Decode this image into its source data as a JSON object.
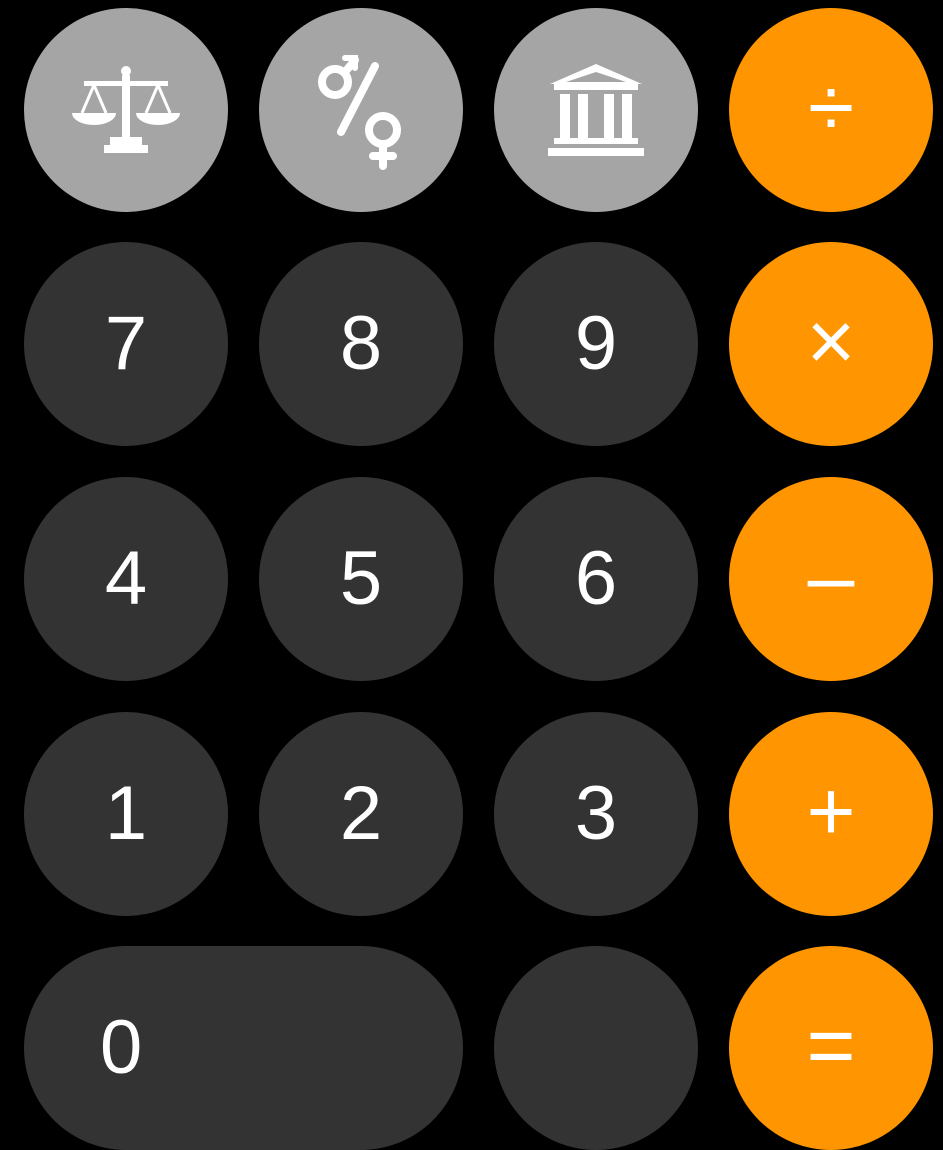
{
  "colors": {
    "background": "#000000",
    "function_key": "#a5a5a5",
    "number_key": "#333333",
    "operator_key": "#ff9500",
    "key_text": "#ffffff"
  },
  "function_keys": [
    {
      "icon": "balance-scale-icon"
    },
    {
      "icon": "male-female-percent-icon"
    },
    {
      "icon": "bank-building-icon"
    }
  ],
  "digits": {
    "seven": "7",
    "eight": "8",
    "nine": "9",
    "four": "4",
    "five": "5",
    "six": "6",
    "one": "1",
    "two": "2",
    "three": "3",
    "zero": "0"
  },
  "operators": {
    "divide": "÷",
    "multiply": "×",
    "subtract": "–",
    "add": "+",
    "equals": "="
  }
}
